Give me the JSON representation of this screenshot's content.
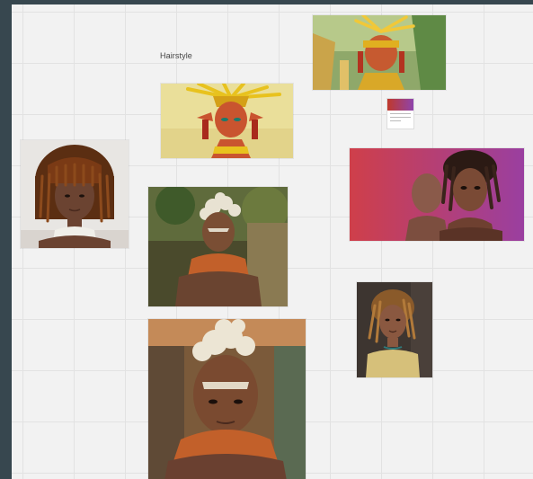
{
  "board": {
    "label": "Hairstyle"
  },
  "colors": {
    "frame": "#37474f",
    "canvas": "#f2f2f2",
    "grid": "#e2e2e2"
  },
  "images": [
    {
      "id": "locs-bangs-portrait"
    },
    {
      "id": "golden-headdress-character"
    },
    {
      "id": "golden-headdress-character-jungle"
    },
    {
      "id": "animated-character-locs"
    },
    {
      "id": "white-hair-character-forest"
    },
    {
      "id": "white-hair-character-closeup"
    },
    {
      "id": "locs-selfie-portrait"
    }
  ]
}
